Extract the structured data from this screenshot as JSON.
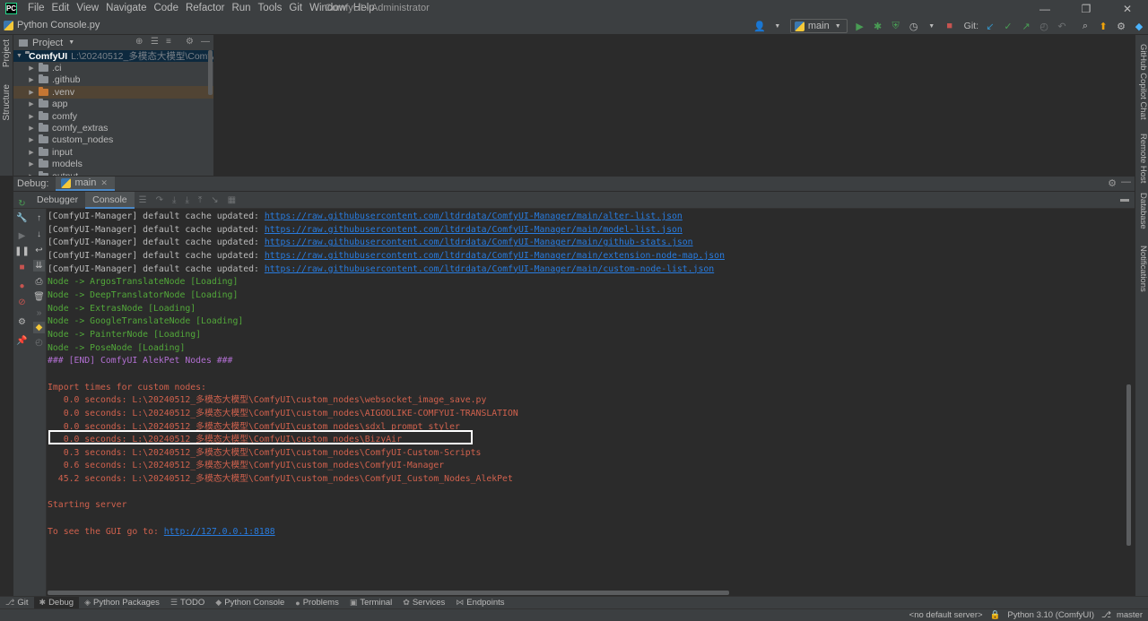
{
  "app": {
    "logo_text": "PC",
    "menu": [
      "File",
      "Edit",
      "View",
      "Navigate",
      "Code",
      "Refactor",
      "Run",
      "Tools",
      "Git",
      "Window",
      "Help"
    ],
    "window_title": "ComfyUI - Administrator"
  },
  "nav": {
    "file": "Python Console.py",
    "run_config": "main",
    "git_label": "Git:"
  },
  "stripe": {
    "left": [
      "Project",
      "Structure"
    ],
    "right": [
      "GitHub Copilot Chat",
      "Remote Host",
      "Database",
      "Notifications"
    ]
  },
  "project": {
    "title": "Project",
    "root": {
      "name": "ComfyUI",
      "path": "L:\\20240512_多模态大模型\\ComfyUI"
    },
    "items": [
      ".ci",
      ".github",
      ".venv",
      "app",
      "comfy",
      "comfy_extras",
      "custom_nodes",
      "input",
      "models",
      "output"
    ]
  },
  "debug": {
    "label": "Debug:",
    "session": "main",
    "tabs": [
      "Debugger",
      "Console"
    ]
  },
  "console": {
    "lines": [
      {
        "text": "[ComfyUI-Manager] default cache updated: ",
        "color": "white",
        "link": "https://raw.githubusercontent.com/ltdrdata/ComfyUI-Manager/main/alter-list.json"
      },
      {
        "text": "[ComfyUI-Manager] default cache updated: ",
        "color": "white",
        "link": "https://raw.githubusercontent.com/ltdrdata/ComfyUI-Manager/main/model-list.json"
      },
      {
        "text": "[ComfyUI-Manager] default cache updated: ",
        "color": "white",
        "link": "https://raw.githubusercontent.com/ltdrdata/ComfyUI-Manager/main/github-stats.json"
      },
      {
        "text": "[ComfyUI-Manager] default cache updated: ",
        "color": "white",
        "link": "https://raw.githubusercontent.com/ltdrdata/ComfyUI-Manager/main/extension-node-map.json"
      },
      {
        "text": "[ComfyUI-Manager] default cache updated: ",
        "color": "white",
        "link": "https://raw.githubusercontent.com/ltdrdata/ComfyUI-Manager/main/custom-node-list.json"
      },
      {
        "text": "Node -> ArgosTranslateNode [Loading]",
        "color": "green"
      },
      {
        "text": "Node -> DeepTranslatorNode [Loading]",
        "color": "green"
      },
      {
        "text": "Node -> ExtrasNode [Loading]",
        "color": "green"
      },
      {
        "text": "Node -> GoogleTranslateNode [Loading]",
        "color": "green"
      },
      {
        "text": "Node -> PainterNode [Loading]",
        "color": "green"
      },
      {
        "text": "Node -> PoseNode [Loading]",
        "color": "green"
      },
      {
        "text": "### [END] ComfyUI AlekPet Nodes ###",
        "color": "purple"
      },
      {
        "text": "",
        "color": "white"
      },
      {
        "text": "Import times for custom nodes:",
        "color": "red"
      },
      {
        "text": "   0.0 seconds: L:\\20240512_多模态大模型\\ComfyUI\\custom_nodes\\websocket_image_save.py",
        "color": "red"
      },
      {
        "text": "   0.0 seconds: L:\\20240512_多模态大模型\\ComfyUI\\custom_nodes\\AIGODLIKE-COMFYUI-TRANSLATION",
        "color": "red"
      },
      {
        "text": "   0.0 seconds: L:\\20240512_多模态大模型\\ComfyUI\\custom_nodes\\sdxl_prompt_styler",
        "color": "red"
      },
      {
        "text": "   0.0 seconds: L:\\20240512_多模态大模型\\ComfyUI\\custom_nodes\\BizyAir",
        "color": "red"
      },
      {
        "text": "   0.3 seconds: L:\\20240512_多模态大模型\\ComfyUI\\custom_nodes\\ComfyUI-Custom-Scripts",
        "color": "red"
      },
      {
        "text": "   0.6 seconds: L:\\20240512_多模态大模型\\ComfyUI\\custom_nodes\\ComfyUI-Manager",
        "color": "red"
      },
      {
        "text": "  45.2 seconds: L:\\20240512_多模态大模型\\ComfyUI\\custom_nodes\\ComfyUI_Custom_Nodes_AlekPet",
        "color": "red"
      },
      {
        "text": "",
        "color": "white"
      },
      {
        "text": "Starting server",
        "color": "red"
      },
      {
        "text": "",
        "color": "white"
      },
      {
        "text": "To see the GUI go to: ",
        "color": "red",
        "link": "http://127.0.0.1:8188"
      }
    ]
  },
  "bottom_tabs": [
    {
      "icon": "git-icon",
      "glyph": "⎇",
      "label": "Git"
    },
    {
      "icon": "debug-icon",
      "glyph": "✱",
      "label": "Debug",
      "active": true
    },
    {
      "icon": "python-packages-icon",
      "glyph": "◈",
      "label": "Python Packages"
    },
    {
      "icon": "todo-icon",
      "glyph": "☰",
      "label": "TODO"
    },
    {
      "icon": "python-console-icon",
      "glyph": "◆",
      "label": "Python Console"
    },
    {
      "icon": "problems-icon",
      "glyph": "●",
      "label": "Problems"
    },
    {
      "icon": "terminal-icon",
      "glyph": "▣",
      "label": "Terminal"
    },
    {
      "icon": "services-icon",
      "glyph": "✿",
      "label": "Services"
    },
    {
      "icon": "endpoints-icon",
      "glyph": "⋈",
      "label": "Endpoints"
    }
  ],
  "status": {
    "interpreter_none": "<no default server>",
    "python": "Python 3.10 (ComfyUI)",
    "branch": "master"
  }
}
